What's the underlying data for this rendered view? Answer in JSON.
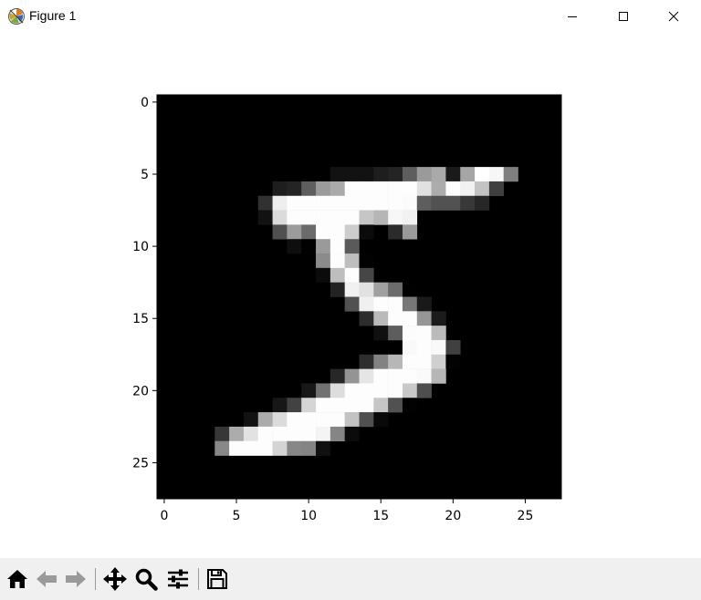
{
  "window": {
    "title": "Figure 1",
    "icons": {
      "app": "matplotlib-icon",
      "minimize": "minimize-icon",
      "maximize": "maximize-icon",
      "close": "close-icon"
    }
  },
  "toolbar": {
    "buttons": [
      {
        "name": "home-button",
        "icon": "home-icon"
      },
      {
        "name": "back-button",
        "icon": "arrow-left-icon"
      },
      {
        "name": "forward-button",
        "icon": "arrow-right-icon"
      },
      {
        "name": "pan-button",
        "icon": "move-icon"
      },
      {
        "name": "zoom-button",
        "icon": "magnifier-icon"
      },
      {
        "name": "configure-subplots-button",
        "icon": "sliders-icon"
      },
      {
        "name": "save-button",
        "icon": "floppy-disk-icon"
      }
    ]
  },
  "chart_data": {
    "type": "heatmap",
    "title": "",
    "xlabel": "",
    "ylabel": "",
    "colormap": "gray",
    "value_range": [
      0,
      255
    ],
    "shape": [
      28,
      28
    ],
    "xlim": [
      -0.5,
      27.5
    ],
    "ylim": [
      27.5,
      -0.5
    ],
    "y_axis_inverted": true,
    "grid": false,
    "legend": "none",
    "xticks": [
      0,
      5,
      10,
      15,
      20,
      25
    ],
    "yticks": [
      0,
      5,
      10,
      15,
      20,
      25
    ],
    "pixels": [
      {
        "row": 5,
        "values": [
          [
            12,
            18
          ],
          [
            13,
            18
          ],
          [
            14,
            18
          ],
          [
            15,
            30
          ],
          [
            16,
            36
          ],
          [
            17,
            94
          ],
          [
            18,
            154
          ],
          [
            19,
            170
          ],
          [
            20,
            26
          ],
          [
            21,
            166
          ],
          [
            22,
            255
          ],
          [
            23,
            247
          ],
          [
            24,
            127
          ]
        ]
      },
      {
        "row": 6,
        "values": [
          [
            8,
            30
          ],
          [
            9,
            36
          ],
          [
            10,
            94
          ],
          [
            11,
            154
          ],
          [
            12,
            170
          ],
          [
            13,
            253
          ],
          [
            14,
            253
          ],
          [
            15,
            253
          ],
          [
            16,
            253
          ],
          [
            17,
            253
          ],
          [
            18,
            225
          ],
          [
            19,
            172
          ],
          [
            20,
            253
          ],
          [
            21,
            242
          ],
          [
            22,
            195
          ],
          [
            23,
            64
          ]
        ]
      },
      {
        "row": 7,
        "values": [
          [
            7,
            49
          ],
          [
            8,
            238
          ],
          [
            9,
            253
          ],
          [
            10,
            253
          ],
          [
            11,
            253
          ],
          [
            12,
            253
          ],
          [
            13,
            253
          ],
          [
            14,
            253
          ],
          [
            15,
            253
          ],
          [
            16,
            253
          ],
          [
            17,
            251
          ],
          [
            18,
            93
          ],
          [
            19,
            82
          ],
          [
            20,
            82
          ],
          [
            21,
            56
          ],
          [
            22,
            39
          ]
        ]
      },
      {
        "row": 8,
        "values": [
          [
            7,
            18
          ],
          [
            8,
            219
          ],
          [
            9,
            253
          ],
          [
            10,
            253
          ],
          [
            11,
            253
          ],
          [
            12,
            253
          ],
          [
            13,
            253
          ],
          [
            14,
            198
          ],
          [
            15,
            182
          ],
          [
            16,
            247
          ],
          [
            17,
            241
          ]
        ]
      },
      {
        "row": 9,
        "values": [
          [
            8,
            80
          ],
          [
            9,
            156
          ],
          [
            10,
            107
          ],
          [
            11,
            253
          ],
          [
            12,
            253
          ],
          [
            13,
            205
          ],
          [
            14,
            11
          ],
          [
            16,
            43
          ],
          [
            17,
            154
          ]
        ]
      },
      {
        "row": 10,
        "values": [
          [
            9,
            14
          ],
          [
            10,
            1
          ],
          [
            11,
            154
          ],
          [
            12,
            253
          ],
          [
            13,
            90
          ]
        ]
      },
      {
        "row": 11,
        "values": [
          [
            11,
            139
          ],
          [
            12,
            253
          ],
          [
            13,
            190
          ],
          [
            14,
            2
          ]
        ]
      },
      {
        "row": 12,
        "values": [
          [
            11,
            11
          ],
          [
            12,
            190
          ],
          [
            13,
            253
          ],
          [
            14,
            70
          ]
        ]
      },
      {
        "row": 13,
        "values": [
          [
            12,
            35
          ],
          [
            13,
            241
          ],
          [
            14,
            225
          ],
          [
            15,
            160
          ],
          [
            16,
            108
          ],
          [
            17,
            1
          ]
        ]
      },
      {
        "row": 14,
        "values": [
          [
            13,
            81
          ],
          [
            14,
            240
          ],
          [
            15,
            253
          ],
          [
            16,
            253
          ],
          [
            17,
            119
          ],
          [
            18,
            25
          ]
        ]
      },
      {
        "row": 15,
        "values": [
          [
            14,
            45
          ],
          [
            15,
            186
          ],
          [
            16,
            253
          ],
          [
            17,
            253
          ],
          [
            18,
            150
          ],
          [
            19,
            27
          ]
        ]
      },
      {
        "row": 16,
        "values": [
          [
            15,
            16
          ],
          [
            16,
            93
          ],
          [
            17,
            252
          ],
          [
            18,
            253
          ],
          [
            19,
            187
          ]
        ]
      },
      {
        "row": 17,
        "values": [
          [
            17,
            249
          ],
          [
            18,
            253
          ],
          [
            19,
            249
          ],
          [
            20,
            64
          ]
        ]
      },
      {
        "row": 18,
        "values": [
          [
            14,
            46
          ],
          [
            15,
            130
          ],
          [
            16,
            183
          ],
          [
            17,
            253
          ],
          [
            18,
            253
          ],
          [
            19,
            207
          ],
          [
            20,
            2
          ]
        ]
      },
      {
        "row": 19,
        "values": [
          [
            12,
            39
          ],
          [
            13,
            148
          ],
          [
            14,
            229
          ],
          [
            15,
            253
          ],
          [
            16,
            253
          ],
          [
            17,
            253
          ],
          [
            18,
            250
          ],
          [
            19,
            182
          ]
        ]
      },
      {
        "row": 20,
        "values": [
          [
            10,
            24
          ],
          [
            11,
            114
          ],
          [
            12,
            221
          ],
          [
            13,
            253
          ],
          [
            14,
            253
          ],
          [
            15,
            253
          ],
          [
            16,
            253
          ],
          [
            17,
            201
          ],
          [
            18,
            78
          ]
        ]
      },
      {
        "row": 21,
        "values": [
          [
            8,
            23
          ],
          [
            9,
            66
          ],
          [
            10,
            213
          ],
          [
            11,
            253
          ],
          [
            12,
            253
          ],
          [
            13,
            253
          ],
          [
            14,
            253
          ],
          [
            15,
            198
          ],
          [
            16,
            81
          ],
          [
            17,
            2
          ]
        ]
      },
      {
        "row": 22,
        "values": [
          [
            6,
            18
          ],
          [
            7,
            171
          ],
          [
            8,
            219
          ],
          [
            9,
            253
          ],
          [
            10,
            253
          ],
          [
            11,
            253
          ],
          [
            12,
            253
          ],
          [
            13,
            195
          ],
          [
            14,
            80
          ],
          [
            15,
            9
          ]
        ]
      },
      {
        "row": 23,
        "values": [
          [
            4,
            55
          ],
          [
            5,
            172
          ],
          [
            6,
            226
          ],
          [
            7,
            253
          ],
          [
            8,
            253
          ],
          [
            9,
            253
          ],
          [
            10,
            253
          ],
          [
            11,
            244
          ],
          [
            12,
            133
          ],
          [
            13,
            11
          ]
        ]
      },
      {
        "row": 24,
        "values": [
          [
            4,
            136
          ],
          [
            5,
            253
          ],
          [
            6,
            253
          ],
          [
            7,
            253
          ],
          [
            8,
            212
          ],
          [
            9,
            135
          ],
          [
            10,
            132
          ],
          [
            11,
            16
          ]
        ]
      }
    ]
  }
}
